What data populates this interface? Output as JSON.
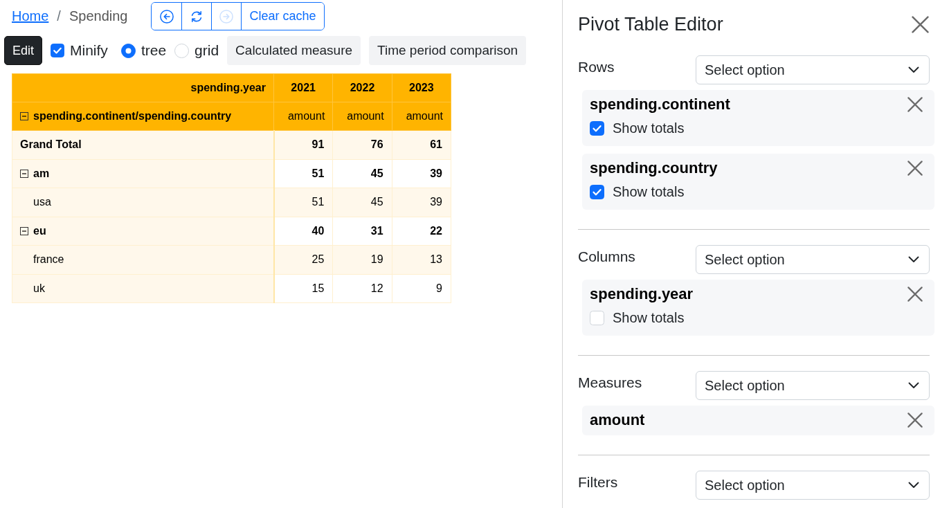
{
  "breadcrumb": {
    "separator": "/",
    "items": [
      {
        "kind": "link",
        "label": "Home"
      },
      {
        "kind": "current",
        "label": "Spending"
      }
    ]
  },
  "cache_toolbar": {
    "buttons": [
      {
        "kind": "back",
        "disabled": false
      },
      {
        "kind": "refresh",
        "disabled": false
      },
      {
        "kind": "forward",
        "disabled": true
      },
      {
        "kind": "text",
        "label": "Clear cache",
        "disabled": false
      }
    ]
  },
  "toolbar": {
    "edit_button": "Edit",
    "minify": {
      "label": "Minify",
      "checked": true
    },
    "layout_options": [
      {
        "label": "tree",
        "selected": true
      },
      {
        "label": "grid",
        "selected": false
      }
    ],
    "buttons": [
      "Calculated measure",
      "Time period comparison"
    ]
  },
  "pivot_table": {
    "column_field": "spending.year",
    "row_header": {
      "label": "spending.continent/spending.country",
      "expanded": true
    },
    "columns": [
      {
        "label": "2021",
        "measure": "amount"
      },
      {
        "label": "2022",
        "measure": "amount"
      },
      {
        "label": "2023",
        "measure": "amount"
      }
    ],
    "rows": [
      {
        "kind": "total",
        "label": "Grand Total",
        "values": [
          "91",
          "76",
          "61"
        ]
      },
      {
        "kind": "group",
        "label": "am",
        "expanded": true,
        "values": [
          "51",
          "45",
          "39"
        ],
        "children": [
          {
            "kind": "leaf",
            "label": "usa",
            "values": [
              "51",
              "45",
              "39"
            ]
          }
        ]
      },
      {
        "kind": "group",
        "label": "eu",
        "expanded": true,
        "values": [
          "40",
          "31",
          "22"
        ],
        "children": [
          {
            "kind": "leaf",
            "label": "france",
            "values": [
              "25",
              "19",
              "13"
            ]
          },
          {
            "kind": "leaf",
            "label": "uk",
            "values": [
              "15",
              "12",
              "9"
            ]
          }
        ]
      }
    ]
  },
  "editor": {
    "title": "Pivot Table Editor",
    "sections": [
      {
        "label": "Rows",
        "placeholder": "Select option",
        "fields": [
          {
            "name": "spending.continent",
            "show_totals": {
              "label": "Show totals",
              "checked": true
            }
          },
          {
            "name": "spending.country",
            "show_totals": {
              "label": "Show totals",
              "checked": true
            }
          }
        ]
      },
      {
        "label": "Columns",
        "placeholder": "Select option",
        "fields": [
          {
            "name": "spending.year",
            "show_totals": {
              "label": "Show totals",
              "checked": false
            }
          }
        ]
      },
      {
        "label": "Measures",
        "placeholder": "Select option",
        "fields": [
          {
            "name": "amount"
          }
        ]
      },
      {
        "label": "Filters",
        "placeholder": "Select option"
      }
    ]
  }
}
